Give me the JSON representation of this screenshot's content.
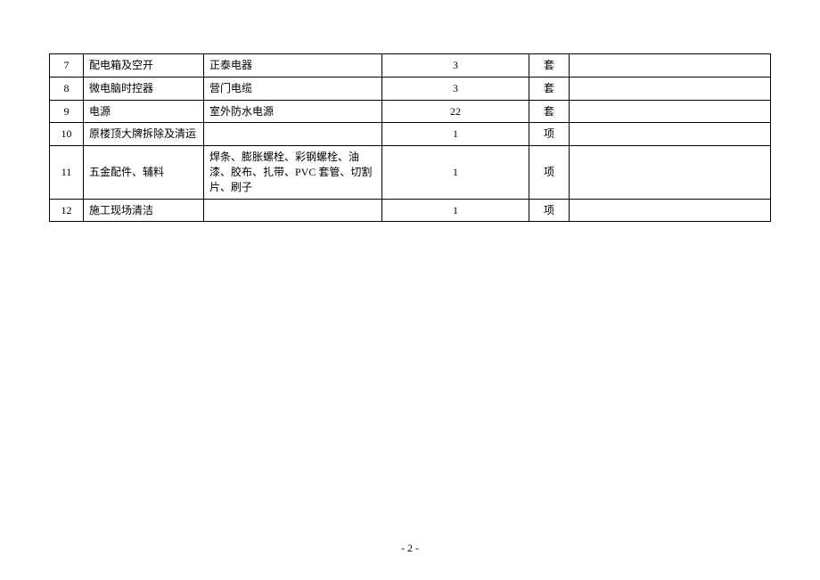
{
  "table": {
    "rows": [
      {
        "no": "7",
        "name": "配电箱及空开",
        "desc": "正泰电器",
        "qty": "3",
        "unit": "套"
      },
      {
        "no": "8",
        "name": "微电脑时控器",
        "desc": "营门电缆",
        "qty": "3",
        "unit": "套"
      },
      {
        "no": "9",
        "name": "电源",
        "desc": "室外防水电源",
        "qty": "22",
        "unit": "套"
      },
      {
        "no": "10",
        "name": "原楼顶大牌拆除及清运",
        "desc": "",
        "qty": "1",
        "unit": "项"
      },
      {
        "no": "11",
        "name": "五金配件、辅料",
        "desc": "焊条、膨胀螺栓、彩钢螺栓、油漆、胶布、扎带、PVC 套管、切割片、刷子",
        "qty": "1",
        "unit": "项"
      },
      {
        "no": "12",
        "name": "施工现场清洁",
        "desc": "",
        "qty": "1",
        "unit": "项"
      }
    ]
  },
  "page_number": "- 2 -"
}
